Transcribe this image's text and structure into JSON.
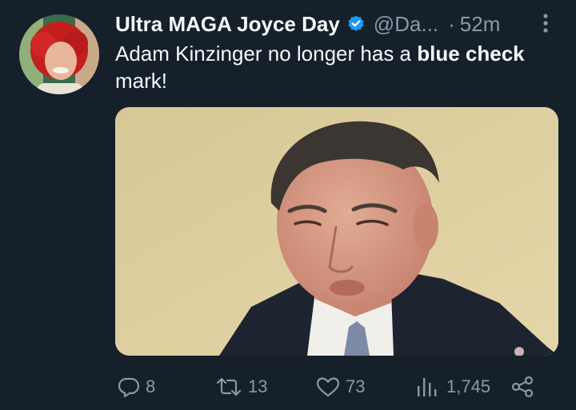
{
  "tweet": {
    "display_name": "Ultra MAGA Joyce Day",
    "handle": "@Da...",
    "separator": "·",
    "time": "52m",
    "text_before": "Adam Kinzinger no longer has a ",
    "text_bold": "blue check",
    "text_after": " mark!",
    "verified": true,
    "media_description": "photo of a man in suit frowning"
  },
  "actions": {
    "replies": "8",
    "retweets": "13",
    "likes": "73",
    "views": "1,745"
  },
  "colors": {
    "background": "#15202b",
    "text": "#f7f9f9",
    "secondary": "#8b98a5",
    "verified": "#1d9bf0"
  },
  "icons": {
    "verified": "verified-badge-icon",
    "more": "more-dots-icon",
    "reply": "reply-icon",
    "retweet": "retweet-icon",
    "like": "heart-icon",
    "views": "views-icon",
    "share": "share-icon"
  }
}
